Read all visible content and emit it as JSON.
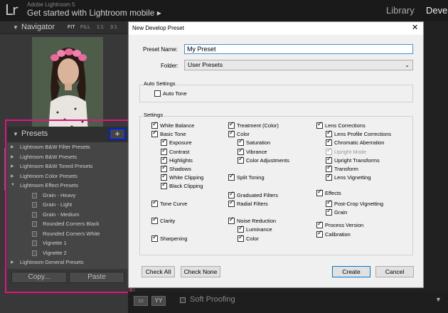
{
  "topbar": {
    "logo": "Lr",
    "app_name": "Adobe Lightroom 5",
    "subtitle": "Get started with Lightroom mobile  ▸",
    "modules": [
      "Library",
      "Develo"
    ]
  },
  "navigator": {
    "title": "Navigator",
    "zoom": [
      "FIT",
      "FILL",
      "1:1",
      "3:1"
    ]
  },
  "presets": {
    "title": "Presets",
    "add_label": "+",
    "rows": [
      {
        "kind": "folder",
        "label": "Lightroom B&W Filter Presets"
      },
      {
        "kind": "folder",
        "label": "Lightroom B&W Presets"
      },
      {
        "kind": "folder",
        "label": "Lightroom B&W Toned Presets"
      },
      {
        "kind": "folder",
        "label": "Lightroom Color Presets"
      },
      {
        "kind": "folder-open",
        "label": "Lightroom Effect Presets"
      },
      {
        "kind": "item",
        "label": "Grain - Heavy"
      },
      {
        "kind": "item",
        "label": "Grain - Light"
      },
      {
        "kind": "item",
        "label": "Grain - Medium"
      },
      {
        "kind": "item",
        "label": "Rounded Corners Black"
      },
      {
        "kind": "item",
        "label": "Rounded Corners White"
      },
      {
        "kind": "item",
        "label": "Vignette 1"
      },
      {
        "kind": "item",
        "label": "Vignette 2"
      },
      {
        "kind": "folder",
        "label": "Lightroom General Presets"
      }
    ]
  },
  "left_buttons": {
    "copy": "Copy...",
    "paste": "Paste"
  },
  "bottombar": {
    "view1": "▭",
    "view2": "YY",
    "soft_proofing": "Soft Proofing"
  },
  "dialog": {
    "title": "New Develop Preset",
    "close": "✕",
    "preset_name_label": "Preset Name:",
    "preset_name_value": "My Preset",
    "folder_label": "Folder:",
    "folder_value": "User Presets",
    "auto_settings_title": "Auto Settings",
    "auto_tone": {
      "label": "Auto Tone",
      "checked": false
    },
    "settings_title": "Settings",
    "col1": [
      {
        "label": "White Balance",
        "checked": true,
        "indent": 0
      },
      {
        "label": "Basic Tone",
        "checked": true,
        "indent": 0
      },
      {
        "label": "Exposure",
        "checked": true,
        "indent": 1
      },
      {
        "label": "Contrast",
        "checked": true,
        "indent": 1
      },
      {
        "label": "Highlights",
        "checked": true,
        "indent": 1
      },
      {
        "label": "Shadows",
        "checked": true,
        "indent": 1
      },
      {
        "label": "White Clipping",
        "checked": true,
        "indent": 1
      },
      {
        "label": "Black Clipping",
        "checked": true,
        "indent": 1
      },
      {
        "label": "Tone Curve",
        "checked": true,
        "indent": 0
      },
      {
        "label": "Clarity",
        "checked": true,
        "indent": 0
      },
      {
        "label": "Sharpening",
        "checked": true,
        "indent": 0
      }
    ],
    "col2": [
      {
        "label": "Treatment (Color)",
        "checked": true,
        "indent": 0
      },
      {
        "label": "Color",
        "checked": true,
        "indent": 0
      },
      {
        "label": "Saturation",
        "checked": true,
        "indent": 1
      },
      {
        "label": "Vibrance",
        "checked": true,
        "indent": 1
      },
      {
        "label": "Color Adjustments",
        "checked": true,
        "indent": 1
      },
      {
        "label": "Split Toning",
        "checked": true,
        "indent": 0
      },
      {
        "label": "Graduated Filters",
        "checked": true,
        "indent": 0
      },
      {
        "label": "Radial Filters",
        "checked": true,
        "indent": 0
      },
      {
        "label": "Noise Reduction",
        "checked": true,
        "indent": 0
      },
      {
        "label": "Luminance",
        "checked": true,
        "indent": 1
      },
      {
        "label": "Color",
        "checked": true,
        "indent": 1
      }
    ],
    "col3": [
      {
        "label": "Lens Corrections",
        "checked": true,
        "indent": 0
      },
      {
        "label": "Lens Profile Corrections",
        "checked": true,
        "indent": 1
      },
      {
        "label": "Chromatic Aberration",
        "checked": true,
        "indent": 1
      },
      {
        "label": "Upright Mode",
        "checked": true,
        "indent": 1,
        "disabled": true
      },
      {
        "label": "Upright Transforms",
        "checked": true,
        "indent": 1
      },
      {
        "label": "Transform",
        "checked": true,
        "indent": 1
      },
      {
        "label": "Lens Vignetting",
        "checked": true,
        "indent": 1
      },
      {
        "label": "Effects",
        "checked": true,
        "indent": 0
      },
      {
        "label": "Post-Crop Vignetting",
        "checked": true,
        "indent": 1
      },
      {
        "label": "Grain",
        "checked": true,
        "indent": 1
      },
      {
        "label": "Process Version",
        "checked": true,
        "indent": 0
      },
      {
        "label": "Calibration",
        "checked": true,
        "indent": 0
      }
    ],
    "buttons": {
      "check_all": "Check All",
      "check_none": "Check None",
      "create": "Create",
      "cancel": "Cancel"
    }
  }
}
